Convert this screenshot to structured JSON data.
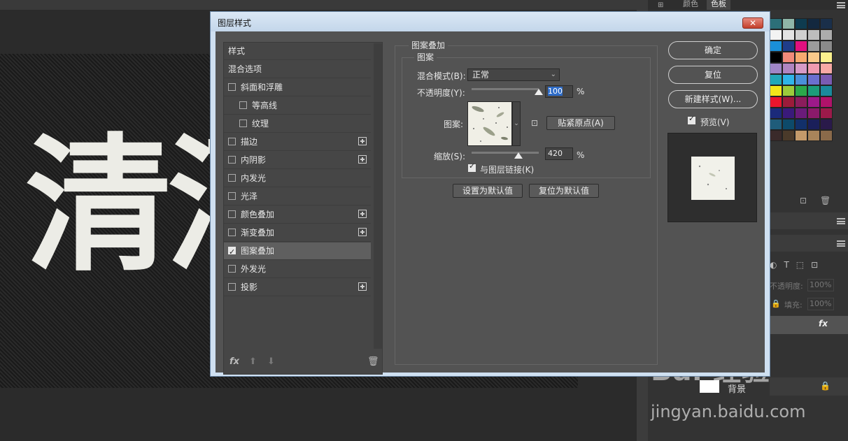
{
  "background": {
    "canvas_text": "清酒",
    "panel_tabs": [
      "颜色",
      "色板"
    ],
    "layer_opacity_label": "不透明度:",
    "layer_opacity_value": "100%",
    "layer_fill_label": "填充:",
    "layer_fill_value": "100%",
    "layer_fx": "fx",
    "background_layer_name": "背景",
    "watermark_text": "Bai 经验",
    "watermark_url": "jingyan.baidu.com"
  },
  "dialog": {
    "title": "图层样式",
    "close": "✕",
    "styles": [
      {
        "label": "样式",
        "checkbox": false,
        "checked": false,
        "plus": false,
        "indent": 0
      },
      {
        "label": "混合选项",
        "checkbox": false,
        "checked": false,
        "plus": false,
        "indent": 0
      },
      {
        "label": "斜面和浮雕",
        "checkbox": true,
        "checked": false,
        "plus": false,
        "indent": 0
      },
      {
        "label": "等高线",
        "checkbox": true,
        "checked": false,
        "plus": false,
        "indent": 1
      },
      {
        "label": "纹理",
        "checkbox": true,
        "checked": false,
        "plus": false,
        "indent": 1
      },
      {
        "label": "描边",
        "checkbox": true,
        "checked": false,
        "plus": true,
        "indent": 0
      },
      {
        "label": "内阴影",
        "checkbox": true,
        "checked": false,
        "plus": true,
        "indent": 0
      },
      {
        "label": "内发光",
        "checkbox": true,
        "checked": false,
        "plus": false,
        "indent": 0
      },
      {
        "label": "光泽",
        "checkbox": true,
        "checked": false,
        "plus": false,
        "indent": 0
      },
      {
        "label": "颜色叠加",
        "checkbox": true,
        "checked": false,
        "plus": true,
        "indent": 0
      },
      {
        "label": "渐变叠加",
        "checkbox": true,
        "checked": false,
        "plus": true,
        "indent": 0
      },
      {
        "label": "图案叠加",
        "checkbox": true,
        "checked": true,
        "plus": false,
        "indent": 0,
        "selected": true
      },
      {
        "label": "外发光",
        "checkbox": true,
        "checked": false,
        "plus": false,
        "indent": 0
      },
      {
        "label": "投影",
        "checkbox": true,
        "checked": false,
        "plus": true,
        "indent": 0
      }
    ],
    "footer_fx": "fx",
    "section_title": "图案叠加",
    "group_title": "图案",
    "blend_mode_label": "混合模式(B):",
    "blend_mode_value": "正常",
    "opacity_label": "不透明度(Y):",
    "opacity_value": "100",
    "percent": "%",
    "opacity_level": 1.0,
    "pattern_label": "图案:",
    "snap_origin_button": "贴紧原点(A)",
    "scale_label": "缩放(S):",
    "scale_value": "420",
    "scale_level": 0.42,
    "link_with_layer_label": "与图层链接(K)",
    "link_with_layer_checked": true,
    "set_default_button": "设置为默认值",
    "reset_default_button": "复位为默认值",
    "ok_button": "确定",
    "reset_button": "复位",
    "new_style_button": "新建样式(W)...",
    "preview_label": "预览(V)",
    "preview_checked": true
  }
}
